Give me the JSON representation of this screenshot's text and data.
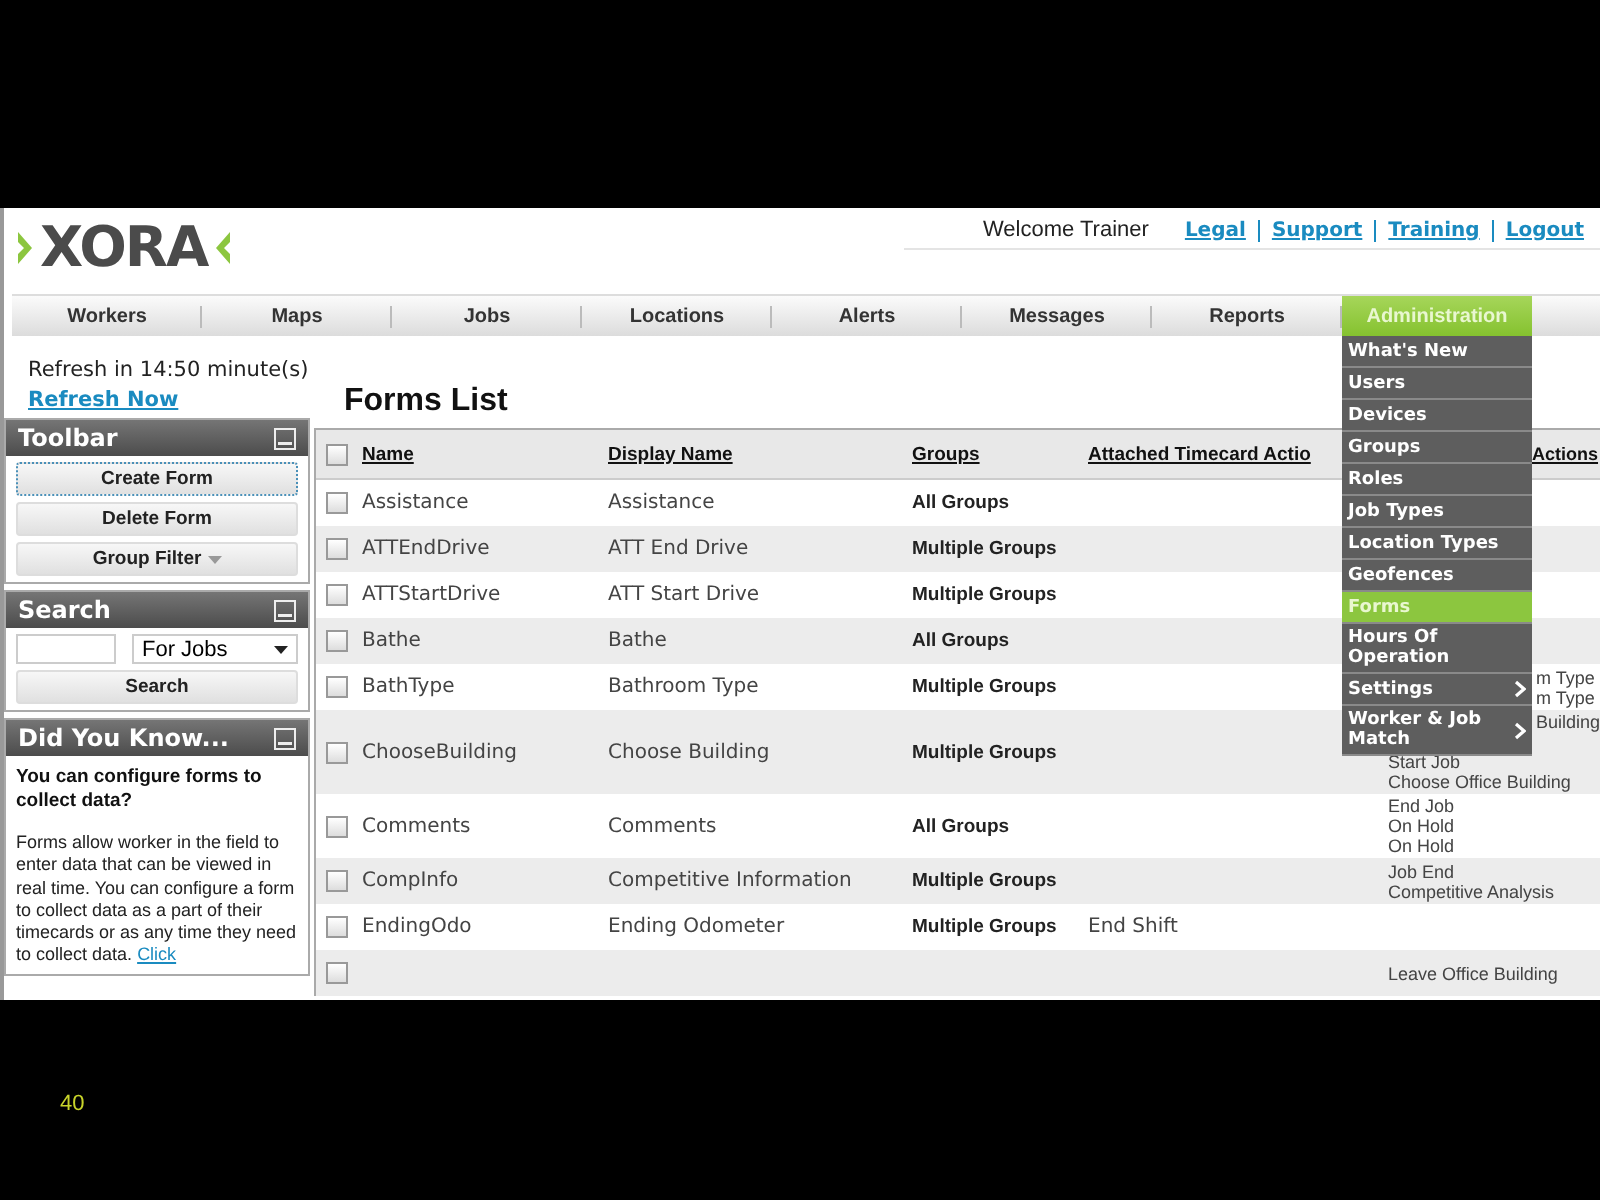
{
  "slide_number": "40",
  "header": {
    "logo": "XORA",
    "welcome": "Welcome Trainer",
    "links": [
      "Legal",
      "Support",
      "Training",
      "Logout"
    ]
  },
  "nav": [
    {
      "label": "Workers",
      "selected": false
    },
    {
      "label": "Maps",
      "selected": false
    },
    {
      "label": "Jobs",
      "selected": false
    },
    {
      "label": "Locations",
      "selected": false
    },
    {
      "label": "Alerts",
      "selected": false
    },
    {
      "label": "Messages",
      "selected": false
    },
    {
      "label": "Reports",
      "selected": false
    },
    {
      "label": "Administration",
      "selected": true
    }
  ],
  "admin_menu": [
    {
      "label": "What's New",
      "selected": false,
      "submenu": false
    },
    {
      "label": "Users",
      "selected": false,
      "submenu": false
    },
    {
      "label": "Devices",
      "selected": false,
      "submenu": false
    },
    {
      "label": "Groups",
      "selected": false,
      "submenu": false
    },
    {
      "label": "Roles",
      "selected": false,
      "submenu": false
    },
    {
      "label": "Job Types",
      "selected": false,
      "submenu": false
    },
    {
      "label": "Location Types",
      "selected": false,
      "submenu": false
    },
    {
      "label": "Geofences",
      "selected": false,
      "submenu": false
    },
    {
      "label": "Forms",
      "selected": true,
      "submenu": false
    },
    {
      "label": "Hours Of Operation",
      "selected": false,
      "submenu": false
    },
    {
      "label": "Settings",
      "selected": false,
      "submenu": true
    },
    {
      "label": "Worker & Job Match",
      "selected": false,
      "submenu": true
    }
  ],
  "sidebar": {
    "refresh_text": "Refresh in 14:50 minute(s)",
    "refresh_link": "Refresh Now",
    "toolbar": {
      "title": "Toolbar",
      "buttons": [
        {
          "label": "Create Form",
          "focused": true,
          "dropdown": false
        },
        {
          "label": "Delete Form",
          "focused": false,
          "dropdown": false
        },
        {
          "label": "Group Filter",
          "focused": false,
          "dropdown": true
        }
      ]
    },
    "search": {
      "title": "Search",
      "select_value": "For Jobs",
      "button": "Search"
    },
    "did_you_know": {
      "title": "Did You Know...",
      "question": "You can configure forms to collect data?",
      "text": "Forms allow worker in the field to enter data that can be viewed in real time. You can configure a form to collect data as a part of their timecards or as any time they need to collect data.",
      "link": "Click"
    }
  },
  "forms_list": {
    "title": "Forms List",
    "select_all_checked": false,
    "columns": [
      "Name",
      "Display Name",
      "Groups",
      "Attached Timecard Actio",
      "Actions"
    ],
    "rows": [
      {
        "name": "Assistance",
        "display_name": "Assistance",
        "groups": "All Groups",
        "checked": false
      },
      {
        "name": "ATTEndDrive",
        "display_name": "ATT End Drive",
        "groups": "Multiple Groups",
        "checked": false
      },
      {
        "name": "ATTStartDrive",
        "display_name": "ATT Start Drive",
        "groups": "Multiple Groups",
        "checked": false
      },
      {
        "name": "Bathe",
        "display_name": "Bathe",
        "groups": "All Groups",
        "checked": false
      },
      {
        "name": "BathType",
        "display_name": "Bathroom Type",
        "groups": "Multiple Groups",
        "checked": false,
        "job_actions": [
          {
            "kind": "fragment",
            "text": "m Type"
          },
          {
            "kind": "fragment",
            "text": "m Type"
          }
        ]
      },
      {
        "name": "ChooseBuilding",
        "display_name": "Choose Building",
        "groups": "Multiple Groups",
        "checked": false,
        "job_actions": [
          {
            "kind": "fragment",
            "text": "Building"
          },
          {
            "kind": "line",
            "text": "Start Job"
          },
          {
            "kind": "line",
            "text": "Choose Office Building"
          }
        ]
      },
      {
        "name": "Comments",
        "display_name": "Comments",
        "groups": "All Groups",
        "checked": false,
        "job_actions": [
          {
            "kind": "line",
            "text": "End Job"
          },
          {
            "kind": "line",
            "text": "On Hold"
          },
          {
            "kind": "line",
            "text": "On Hold"
          }
        ]
      },
      {
        "name": "CompInfo",
        "display_name": "Competitive Information",
        "groups": "Multiple Groups",
        "checked": false,
        "job_actions": [
          {
            "kind": "line",
            "text": "Job End"
          },
          {
            "kind": "line",
            "text": "Competitive Analysis"
          }
        ]
      },
      {
        "name": "EndingOdo",
        "display_name": "Ending Odometer",
        "groups": "Multiple Groups",
        "attached_actions": "End Shift",
        "checked": false
      },
      {
        "checked": false,
        "job_actions": [
          {
            "kind": "line",
            "text": "Leave Office Building"
          }
        ]
      }
    ]
  }
}
